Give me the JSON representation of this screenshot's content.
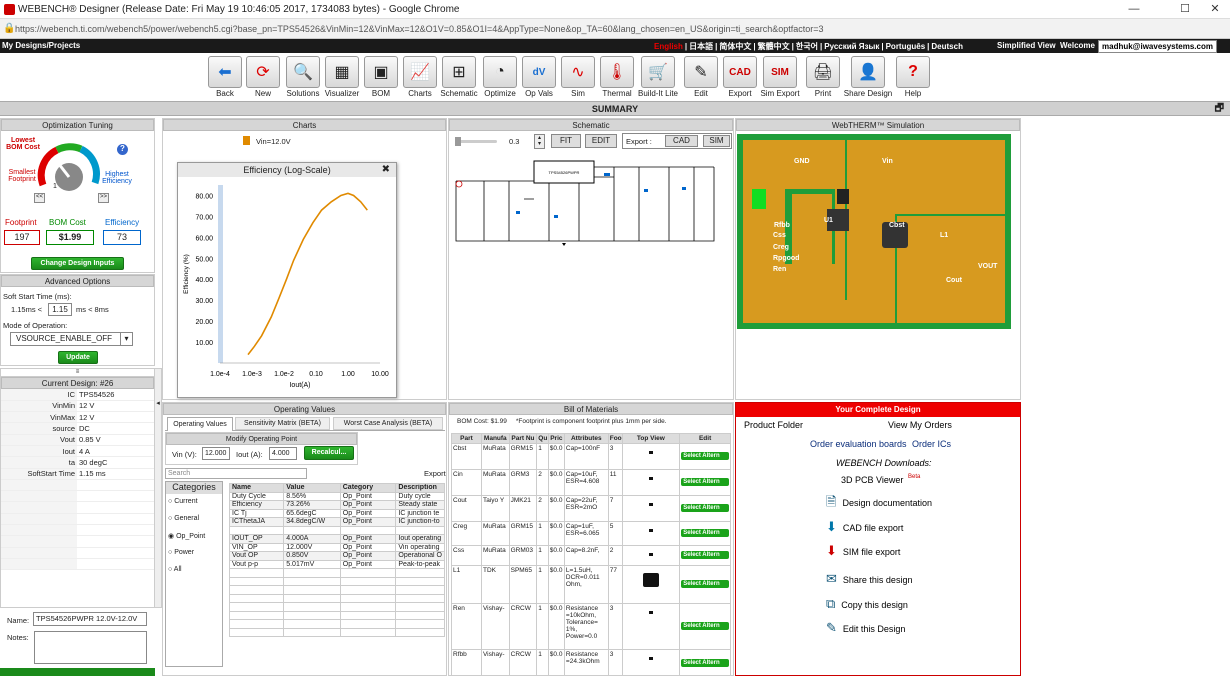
{
  "window": {
    "title": "WEBENCH® Designer (Release Date: Fri May 19 10:46:05 2017, 1734083 bytes) - Google Chrome",
    "url": "https://webench.ti.com/webench5/power/webench5.cgi?base_pn=TPS54526&VinMin=12&VinMax=12&O1V=0.85&O1I=4&AppType=None&op_TA=60&lang_chosen=en_US&origin=ti_search&optfactor=3"
  },
  "topbar": {
    "my_designs": "My Designs/Projects",
    "languages": [
      "English",
      "日本語",
      "简体中文",
      "繁體中文",
      "한국어",
      "Русский Язык",
      "Português",
      "Deutsch"
    ],
    "simplified": "Simplified View",
    "welcome": "Welcome",
    "user": "madhuk@iwavesystems.com"
  },
  "toolbar": [
    {
      "label": "Back",
      "icon": "back-arrow-icon"
    },
    {
      "label": "New",
      "icon": "refresh-icon"
    },
    {
      "label": "Solutions",
      "icon": "magnifier-icon"
    },
    {
      "label": "Visualizer",
      "icon": "grid-icon"
    },
    {
      "label": "BOM",
      "icon": "components-icon"
    },
    {
      "label": "Charts",
      "icon": "chart-icon"
    },
    {
      "label": "Schematic",
      "icon": "schematic-icon"
    },
    {
      "label": "Optimize",
      "icon": "dial-icon"
    },
    {
      "label": "Op Vals",
      "icon": "dvdt-icon"
    },
    {
      "label": "Sim",
      "icon": "sine-icon"
    },
    {
      "label": "Thermal",
      "icon": "thermometer-icon"
    },
    {
      "label": "Build-It Lite",
      "icon": "cart-icon"
    },
    {
      "label": "Edit",
      "icon": "pencil-icon"
    },
    {
      "label": "Export",
      "icon": "cad-icon"
    },
    {
      "label": "Sim Export",
      "icon": "sim-icon"
    },
    {
      "label": "Print",
      "icon": "printer-icon"
    },
    {
      "label": "Share Design",
      "icon": "person-icon"
    },
    {
      "label": "Help",
      "icon": "help-icon"
    }
  ],
  "summary": "SUMMARY",
  "opt": {
    "header": "Optimization Tuning",
    "lowest": "Lowest BOM Cost",
    "smallest": "Smallest Footprint",
    "highest": "Highest Efficiency",
    "dial_num": "1",
    "help": "?",
    "prev": "<<",
    "next": ">>",
    "footprint_label": "Footprint",
    "bom_label": "BOM Cost",
    "eff_label": "Efficiency",
    "footprint": "197",
    "bom": "$1.99",
    "eff": "73",
    "change_btn": "Change Design Inputs"
  },
  "adv": {
    "header": "Advanced Options",
    "softstart": "Soft Start Time (ms):",
    "ss_min": "1.15ms <",
    "ss_val": "1.15",
    "ss_max": "ms < 8ms",
    "mode_label": "Mode of Operation:",
    "mode_val": "VSOURCE_ENABLE_OFF",
    "update": "Update"
  },
  "current_design": {
    "header": "Current Design: #26",
    "rows": [
      [
        "IC",
        "TPS54526"
      ],
      [
        "VinMin",
        "12 V"
      ],
      [
        "VinMax",
        "12 V"
      ],
      [
        "source",
        "DC"
      ],
      [
        "Vout",
        "0.85 V"
      ],
      [
        "Iout",
        "4 A"
      ],
      [
        "ta",
        "30 degC"
      ],
      [
        "SoftStart Time",
        "1.15 ms"
      ]
    ],
    "name_label": "Name:",
    "name_val": "TPS54526PWPR 12.0V-12.0V",
    "notes_label": "Notes:"
  },
  "charts": {
    "header": "Charts",
    "legend": "Vin=12.0V",
    "popup_title": "Efficiency (Log-Scale)",
    "close": "✖",
    "ylabel": "Efficiency (%)",
    "xlabel": "Iout(A)"
  },
  "chart_data": {
    "type": "line",
    "title": "Efficiency (Log-Scale)",
    "xlabel": "Iout(A)",
    "ylabel": "Efficiency (%)",
    "x_ticks": [
      "1.0e-4",
      "1.0e-3",
      "1.0e-2",
      "0.10",
      "1.00",
      "10.00"
    ],
    "y_ticks": [
      "10.00",
      "20.00",
      "30.00",
      "40.00",
      "50.00",
      "60.00",
      "70.00",
      "80.00"
    ],
    "ylim": [
      0,
      85
    ],
    "xlog": true,
    "xlim": [
      0.0001,
      10
    ],
    "series": [
      {
        "name": "Vin=12.0V",
        "color": "#e08a00",
        "x": [
          0.00075,
          0.0012,
          0.002,
          0.004,
          0.007,
          0.012,
          0.02,
          0.04,
          0.08,
          0.15,
          0.3,
          0.6,
          1.0,
          1.5,
          2.5,
          4.0
        ],
        "y": [
          4,
          8,
          13,
          22,
          31,
          40,
          49,
          59,
          67,
          73,
          77,
          80,
          81,
          80,
          77,
          73
        ]
      }
    ]
  },
  "schematic": {
    "header": "Schematic",
    "zoom": "0.3",
    "fit": "FIT",
    "edit": "EDIT",
    "export": "Export :",
    "cad": "CAD",
    "sim": "SIM"
  },
  "thermal": {
    "header": "WebTHERM™ Simulation",
    "labels": [
      "GND",
      "Vin",
      "U1",
      "Cbst",
      "Rfbb",
      "Css",
      "Creg",
      "Rpgood",
      "Ren",
      "L1",
      "VOUT",
      "Cout",
      "GND1"
    ]
  },
  "opvals": {
    "header": "Operating Values",
    "tabs": [
      "Operating Values",
      "Sensitivity Matrix (BETA)",
      "Worst Case Analysis (BETA)"
    ],
    "modify": "Modify Operating Point",
    "vin_label": "Vin (V):",
    "vin_val": "12.000",
    "iout_label": "Iout (A):",
    "iout_val": "4.000",
    "recalc": "Recalcul...",
    "search_ph": "Search",
    "export": "Export",
    "cat_header": "Categories",
    "cats": [
      "Current",
      "General",
      "Op_Point",
      "Power",
      "All"
    ],
    "cols": [
      "Name",
      "Value",
      "Category",
      "Description"
    ],
    "rows": [
      [
        "Duty Cycle",
        "8.56%",
        "Op_Point",
        "Duty cycle"
      ],
      [
        "Efficiency",
        "73.26%",
        "Op_Point",
        "Steady state"
      ],
      [
        "IC Tj",
        "65.6degC",
        "Op_Point",
        "IC junction te"
      ],
      [
        "ICThetaJA",
        "34.8degC/W",
        "Op_Point",
        "IC junction-to"
      ],
      [
        "",
        "",
        "",
        ""
      ],
      [
        "IOUT_OP",
        "4.000A",
        "Op_Point",
        "Iout operating"
      ],
      [
        "VIN_OP",
        "12.000V",
        "Op_Point",
        "Vin operating"
      ],
      [
        "Vout OP",
        "0.850V",
        "Op_Point",
        "Operational O"
      ],
      [
        "Vout p-p",
        "5.017mV",
        "Op_Point",
        "Peak-to-peak"
      ]
    ]
  },
  "bom": {
    "header": "Bill of Materials",
    "note": "BOM Cost: $1.99     *Footprint is component footprint plus 1mm per side.",
    "cols": [
      "Part",
      "Manufa",
      "Part Nu",
      "Qu",
      "Pric",
      "Attributes",
      "Foo",
      "Top View",
      "Edit"
    ],
    "rows": [
      [
        "Cbst",
        "MuRata",
        "GRM15",
        "1",
        "$0.0",
        "Cap=100nF",
        "3"
      ],
      [
        "Cin",
        "MuRata",
        "GRM3",
        "2",
        "$0.0",
        "Cap=10uF, ESR=4.608",
        "11"
      ],
      [
        "Cout",
        "Taiyo Y",
        "JMK21",
        "2",
        "$0.0",
        "Cap=22uF, ESR=2mO",
        "7"
      ],
      [
        "Creg",
        "MuRata",
        "GRM15",
        "1",
        "$0.0",
        "Cap=1uF, ESR=6.065",
        "5"
      ],
      [
        "Css",
        "MuRata",
        "GRM03",
        "1",
        "$0.0",
        "Cap=8.2nF,",
        "2"
      ],
      [
        "L1",
        "TDK",
        "SPM65",
        "1",
        "$0.0",
        "L=1.5uH, DCR=0.011 Ohm,",
        "77"
      ],
      [
        "Ren",
        "Vishay-",
        "CRCW",
        "1",
        "$0.0",
        "Resistance =10kOhm, Tolerance= 1%, Power=0.0",
        "3"
      ],
      [
        "Rfbb",
        "Vishay-",
        "CRCW",
        "1",
        "$0.0",
        "Resistance =24.3kOhm",
        "3"
      ]
    ],
    "select": "Select Altern"
  },
  "complete": {
    "header": "Your Complete Design",
    "product_folder": "Product Folder",
    "view_orders": "View My Orders",
    "order_boards": "Order evaluation boards",
    "order_ics": "Order ICs",
    "downloads": "WEBENCH Downloads:",
    "viewer": "3D PCB Viewer",
    "beta": "Beta",
    "items": [
      "Design documentation",
      "CAD file export",
      "SIM file export",
      "Share this design",
      "Copy this design",
      "Edit this Design"
    ]
  }
}
